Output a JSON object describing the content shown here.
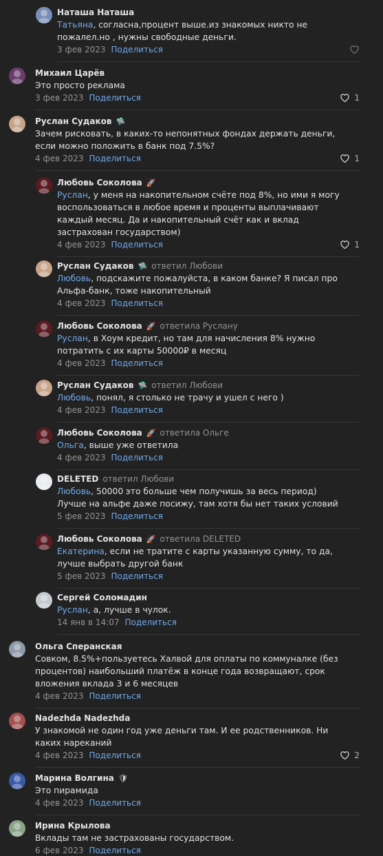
{
  "comments": [
    {
      "author": "Наташа Наташа",
      "badge": "",
      "reply_to": "",
      "mention": "Татьяна",
      "text": ", согласна,процент выше.из знакомых никто не пожалел.но , нужны свободные деньги.",
      "date": "3 фев 2023",
      "share": "Поделиться",
      "likes": "",
      "liked": false,
      "nested": true,
      "avatar_color": "#7a8fb8"
    },
    {
      "author": "Михаил Царёв",
      "badge": "",
      "reply_to": "",
      "mention": "",
      "text": "Это просто реклама",
      "date": "3 фев 2023",
      "share": "Поделиться",
      "likes": "1",
      "liked": true,
      "nested": false,
      "avatar_color": "#6b3d6e"
    },
    {
      "author": "Руслан Судаков",
      "badge": "🛸",
      "reply_to": "",
      "mention": "",
      "text": "Зачем рисковать, в каких-то непонятных фондах держать деньги, если можно положить в банк под 7.5%?",
      "date": "4 фев 2023",
      "share": "Поделиться",
      "likes": "1",
      "liked": true,
      "nested": false,
      "avatar_color": "#c8a58a"
    },
    {
      "author": "Любовь Соколова",
      "badge": "🚀",
      "reply_to": "",
      "mention": "Руслан",
      "text": ", у меня на накопительном счёте под 8%, но ими я могу воспользоваться в любое время и проценты выплачивают каждый месяц. Да и накопительный счёт как и вклад застрахован государством)",
      "date": "4 фев 2023",
      "share": "Поделиться",
      "likes": "1",
      "liked": true,
      "nested": true,
      "avatar_color": "#5a1c22"
    },
    {
      "author": "Руслан Судаков",
      "badge": "🛸",
      "reply_to": "ответил Любови",
      "mention": "Любовь",
      "text": ", подскажите пожалуйста, в каком банке? Я писал про Альфа-банк, тоже накопительный",
      "date": "4 фев 2023",
      "share": "Поделиться",
      "likes": "",
      "liked": false,
      "nested": true,
      "avatar_color": "#c8a58a"
    },
    {
      "author": "Любовь Соколова",
      "badge": "🚀",
      "reply_to": "ответила Руслану",
      "mention": "Руслан",
      "text": ", в Хоум кредит, но там для начисления 8% нужно потратить с их карты 50000₽ в месяц",
      "date": "4 фев 2023",
      "share": "Поделиться",
      "likes": "",
      "liked": false,
      "nested": true,
      "avatar_color": "#5a1c22"
    },
    {
      "author": "Руслан Судаков",
      "badge": "🛸",
      "reply_to": "ответил Любови",
      "mention": "Любовь",
      "text": ", понял, я столько не трачу и ушел с него )",
      "date": "4 фев 2023",
      "share": "Поделиться",
      "likes": "",
      "liked": false,
      "nested": true,
      "avatar_color": "#c8a58a"
    },
    {
      "author": "Любовь Соколова",
      "badge": "🚀",
      "reply_to": "ответила Ольге",
      "mention": "Ольга",
      "text": ", выше уже ответила",
      "date": "4 фев 2023",
      "share": "Поделиться",
      "likes": "",
      "liked": false,
      "nested": true,
      "avatar_color": "#5a1c22"
    },
    {
      "author": "DELETED",
      "badge": "",
      "reply_to": "ответил Любови",
      "mention": "Любовь",
      "text": ", 50000 это больше чем получишь за весь период) Лучше на альфе даже посижу, там хотя бы нет таких условий",
      "date": "5 фев 2023",
      "share": "Поделиться",
      "likes": "",
      "liked": false,
      "nested": true,
      "avatar_color": "#e8ecf0"
    },
    {
      "author": "Любовь Соколова",
      "badge": "🚀",
      "reply_to": "ответила DELETED",
      "mention": "Екатерина",
      "text": ", если не тратите с карты указанную сумму, то да, лучше выбрать другой банк",
      "date": "5 фев 2023",
      "share": "Поделиться",
      "likes": "",
      "liked": false,
      "nested": true,
      "avatar_color": "#5a1c22"
    },
    {
      "author": "Сергей Соломадин",
      "badge": "",
      "reply_to": "",
      "mention": "Руслан",
      "text": ", а, лучше в чулок.",
      "date": "14 янв в 14:07",
      "share": "Поделиться",
      "likes": "",
      "liked": false,
      "nested": true,
      "avatar_color": "#c5cad1"
    },
    {
      "author": "Ольга Сперанская",
      "badge": "",
      "reply_to": "",
      "mention": "",
      "text": "Совком, 8.5%+пользуетесь Халвой для оплаты по коммуналке (без процентов) наибольший платёж в конце года возвращают, срок вложения вклада 3 и 6 месяцев",
      "date": "4 фев 2023",
      "share": "Поделиться",
      "likes": "",
      "liked": false,
      "nested": false,
      "avatar_color": "#8d9aa8"
    },
    {
      "author": "Nadezhda Nadezhda",
      "badge": "",
      "reply_to": "",
      "mention": "",
      "text": "У знакомой не один год уже деньги там. И ее родственников. Ни каких нареканий",
      "date": "4 фев 2023",
      "share": "Поделиться",
      "likes": "2",
      "liked": true,
      "nested": false,
      "avatar_color": "#a35050"
    },
    {
      "author": "Марина Волгина",
      "badge": "🛡",
      "reply_to": "",
      "mention": "",
      "text": "Это пирамида",
      "date": "4 фев 2023",
      "share": "Поделиться",
      "likes": "",
      "liked": false,
      "nested": false,
      "avatar_color": "#3a5aa8"
    },
    {
      "author": "Ирина Крылова",
      "badge": "",
      "reply_to": "",
      "mention": "",
      "text": "Вклады там не застрахованы государством.",
      "date": "6 фев 2023",
      "share": "Поделиться",
      "likes": "",
      "liked": false,
      "nested": false,
      "avatar_color": "#8aa38a"
    }
  ]
}
